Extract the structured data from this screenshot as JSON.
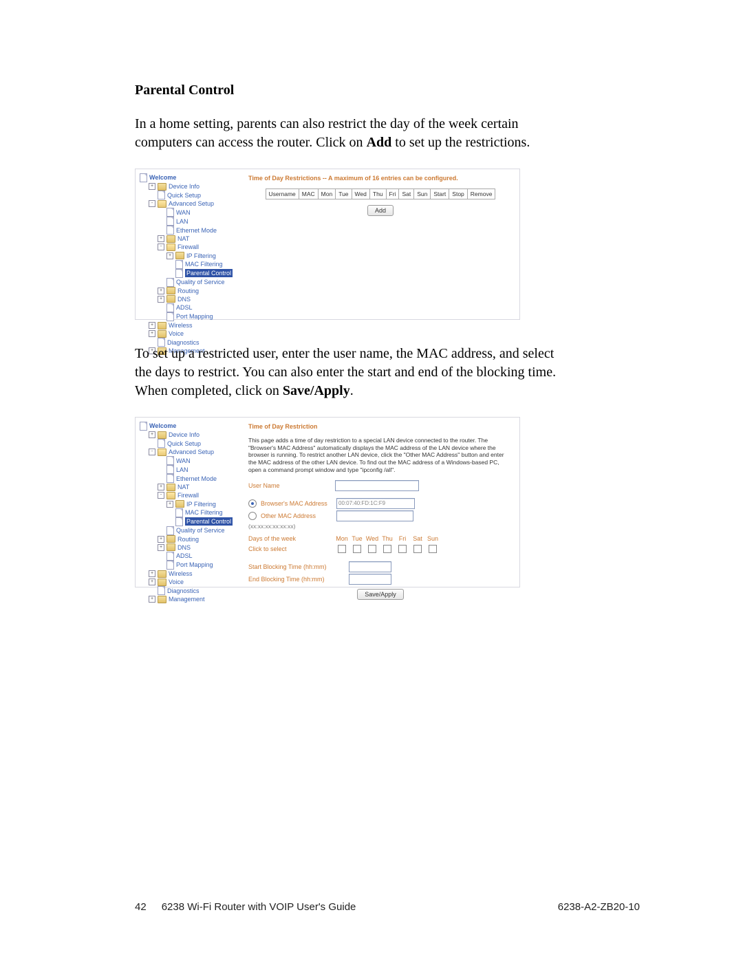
{
  "doc": {
    "section_title": "Parental Control",
    "para1_a": "In a home setting, parents can also restrict the day of the week certain computers can access the router. Click on ",
    "para1_bold": "Add",
    "para1_b": " to set up the restrictions.",
    "para2_a": "To set up a restricted user, enter the user name, the MAC address, and select the days to restrict. You can also enter the start and end of the blocking time. When completed, click on ",
    "para2_bold": "Save/Apply",
    "para2_b": "."
  },
  "nav": {
    "welcome": "Welcome",
    "device_info": "Device Info",
    "quick_setup": "Quick Setup",
    "advanced_setup": "Advanced Setup",
    "wan": "WAN",
    "lan": "LAN",
    "ethernet_mode": "Ethernet Mode",
    "nat": "NAT",
    "firewall": "Firewall",
    "ip_filtering": "IP Filtering",
    "mac_filtering": "MAC Filtering",
    "parental_control": "Parental Control",
    "qos": "Quality of Service",
    "routing": "Routing",
    "dns": "DNS",
    "adsl": "ADSL",
    "port_mapping": "Port Mapping",
    "wireless": "Wireless",
    "voice": "Voice",
    "diagnostics": "Diagnostics",
    "management": "Management"
  },
  "shot1": {
    "title": "Time of Day Restrictions -- A maximum of 16 entries can be configured.",
    "headers": [
      "Username",
      "MAC",
      "Mon",
      "Tue",
      "Wed",
      "Thu",
      "Fri",
      "Sat",
      "Sun",
      "Start",
      "Stop",
      "Remove"
    ],
    "add_btn": "Add"
  },
  "shot2": {
    "title": "Time of Day Restriction",
    "desc": "This page adds a time of day restriction to a special LAN device connected to the router. The \"Browser's MAC Address\" automatically displays the MAC address of the LAN device where the browser is running. To restrict another LAN device, click the \"Other MAC Address\" button and enter the MAC address of the other LAN device. To find out the MAC address of a Windows-based PC, open a command prompt window and type \"ipconfig /all\".",
    "user_name_label": "User Name",
    "browser_mac_label": "Browser's MAC Address",
    "browser_mac_value": "00:07:40:FD:1C:F9",
    "other_mac_label": "Other MAC Address",
    "other_mac_hint": "(xx:xx:xx:xx:xx:xx)",
    "days_label": "Days of the week",
    "days_head": [
      "Mon",
      "Tue",
      "Wed",
      "Thu",
      "Fri",
      "Sat",
      "Sun"
    ],
    "click_to_select": "Click to select",
    "start_label": "Start Blocking Time (hh:mm)",
    "end_label": "End Blocking Time (hh:mm)",
    "save_btn": "Save/Apply"
  },
  "footer": {
    "page_no": "42",
    "book": "6238 Wi-Fi Router with VOIP User's Guide",
    "doc_no": "6238-A2-ZB20-10"
  }
}
